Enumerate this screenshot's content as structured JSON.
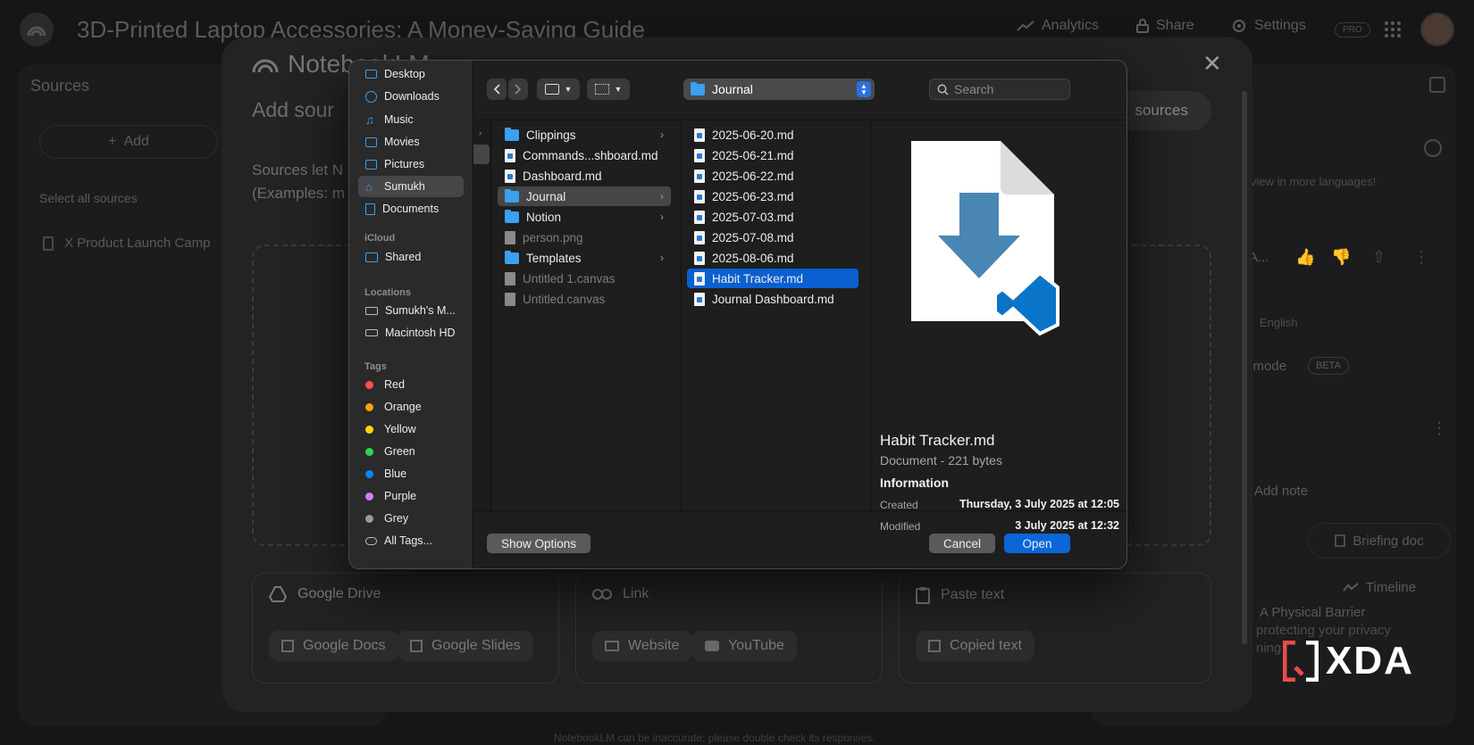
{
  "app": {
    "title": "3D-Printed Laptop Accessories: A Money-Saving Guide",
    "analytics": "Analytics",
    "share": "Share",
    "settings": "Settings",
    "pro_badge": "PRO"
  },
  "sources_panel": {
    "title": "Sources",
    "add": "Add",
    "select_all": "Select all sources",
    "item": "X Product Launch Camp"
  },
  "studio_panel": {
    "languages_hint": "view in more languages!",
    "row_title": "A...",
    "english": "English",
    "mode": "e mode",
    "beta": "BETA",
    "add_note": "Add note",
    "briefing_doc": "Briefing doc",
    "timeline": "Timeline",
    "note_title": "A Physical Barrier",
    "note_text": "protecting your privacy",
    "note_text2": "ning"
  },
  "footer_note": "NotebookLM can be inaccurate; please double check its responses.",
  "modal": {
    "logo": "NotebookLM",
    "heading": "Add sour",
    "discover": "sources",
    "desc_line1": "Sources let N",
    "desc_line2": "(Examples: m",
    "cards": {
      "drive": {
        "title": "Google Drive",
        "chips": [
          "Google Docs",
          "Google Slides"
        ]
      },
      "link": {
        "title": "Link",
        "chips": [
          "Website",
          "YouTube"
        ]
      },
      "paste": {
        "title": "Paste text",
        "chips": [
          "Copied text"
        ]
      }
    }
  },
  "dialog": {
    "location": "Journal",
    "search_placeholder": "Search",
    "favorites": [
      "Desktop",
      "Downloads",
      "Music",
      "Movies",
      "Pictures",
      "Sumukh",
      "Documents"
    ],
    "icloud_header": "iCloud",
    "icloud": [
      "Shared"
    ],
    "locations_header": "Locations",
    "locations": [
      "Sumukh's M...",
      "Macintosh HD"
    ],
    "tags_header": "Tags",
    "tags": [
      {
        "name": "Red",
        "color": "#ff4f4f"
      },
      {
        "name": "Orange",
        "color": "#ff9f0a"
      },
      {
        "name": "Yellow",
        "color": "#ffd60a"
      },
      {
        "name": "Green",
        "color": "#30d158"
      },
      {
        "name": "Blue",
        "color": "#0a84ff"
      },
      {
        "name": "Purple",
        "color": "#d77bf2"
      },
      {
        "name": "Grey",
        "color": "#98989d"
      }
    ],
    "all_tags": "All Tags...",
    "column1": [
      {
        "name": "Clippings",
        "type": "folder"
      },
      {
        "name": "Commands...shboard.md",
        "type": "doc"
      },
      {
        "name": "Dashboard.md",
        "type": "doc"
      },
      {
        "name": "Journal",
        "type": "folder"
      },
      {
        "name": "Notion",
        "type": "folder"
      },
      {
        "name": "person.png",
        "type": "image"
      },
      {
        "name": "Templates",
        "type": "folder"
      },
      {
        "name": "Untitled 1.canvas",
        "type": "grey"
      },
      {
        "name": "Untitled.canvas",
        "type": "grey"
      }
    ],
    "column2": [
      "2025-06-20.md",
      "2025-06-21.md",
      "2025-06-22.md",
      "2025-06-23.md",
      "2025-07-03.md",
      "2025-07-08.md",
      "2025-08-06.md",
      "Habit Tracker.md",
      "Journal Dashboard.md"
    ],
    "preview": {
      "filename": "Habit Tracker.md",
      "kind": "Document - 221 bytes",
      "info_header": "Information",
      "created_label": "Created",
      "created_value": "Thursday, 3 July 2025 at 12:05",
      "modified_label": "Modified",
      "modified_value": "3 July 2025 at 12:32"
    },
    "show_options": "Show Options",
    "cancel": "Cancel",
    "open": "Open"
  },
  "watermark": "XDA"
}
